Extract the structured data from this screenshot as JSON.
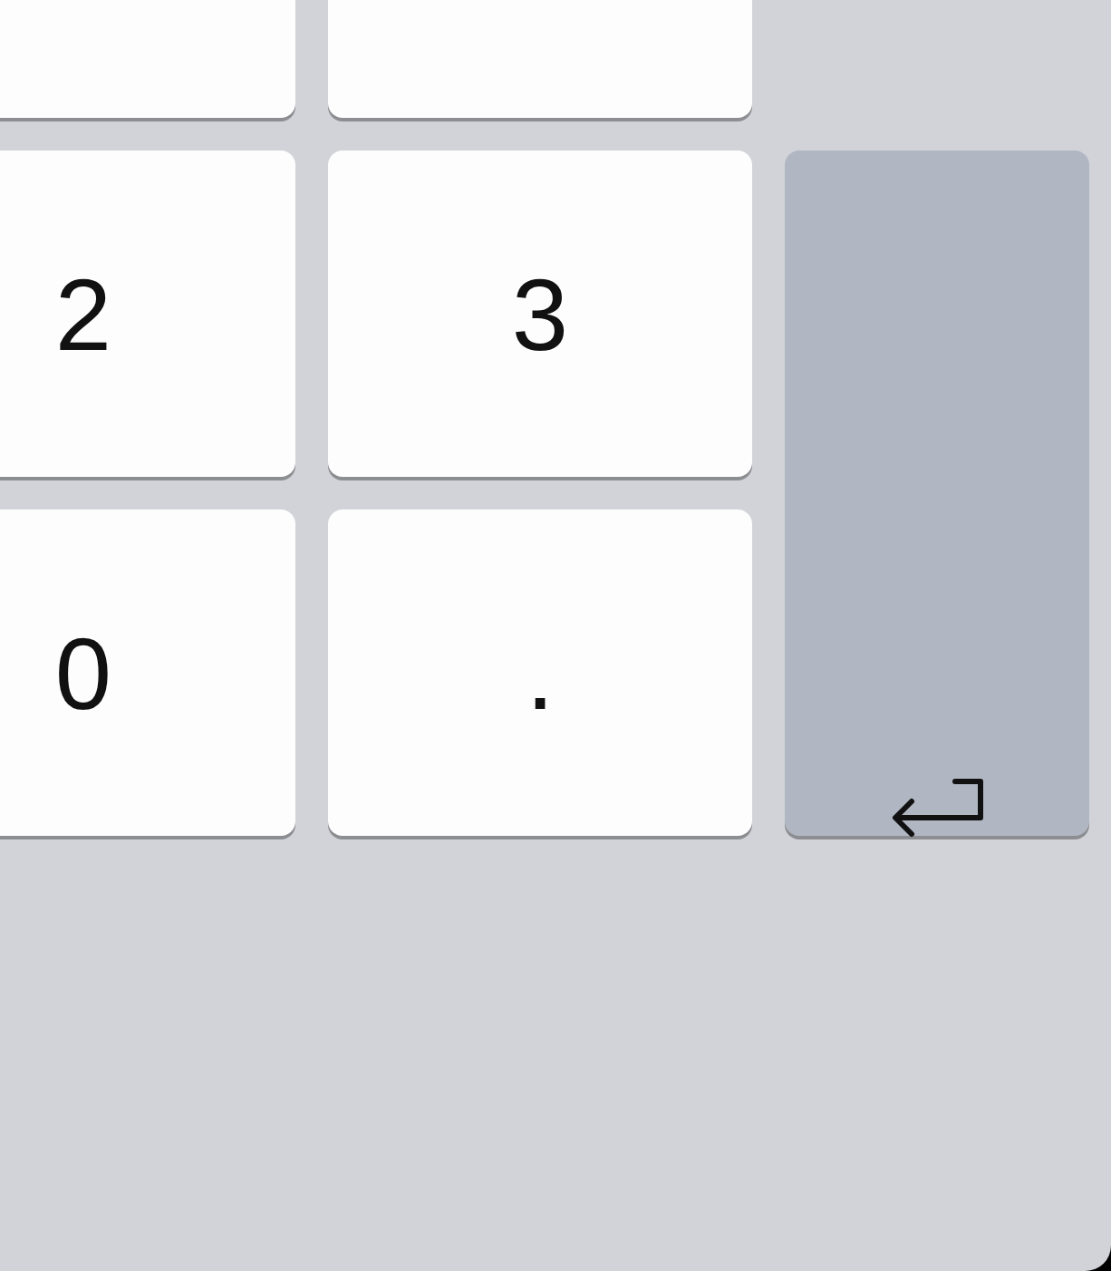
{
  "keys": [
    {
      "kind": "digit"
    },
    {
      "kind": "digit"
    },
    {
      "kind": "digit",
      "label": "2"
    },
    {
      "kind": "digit",
      "label": "3"
    },
    {
      "kind": "enter"
    },
    {
      "kind": "digit",
      "label": "0"
    },
    {
      "kind": "digit",
      "label": "."
    }
  ]
}
